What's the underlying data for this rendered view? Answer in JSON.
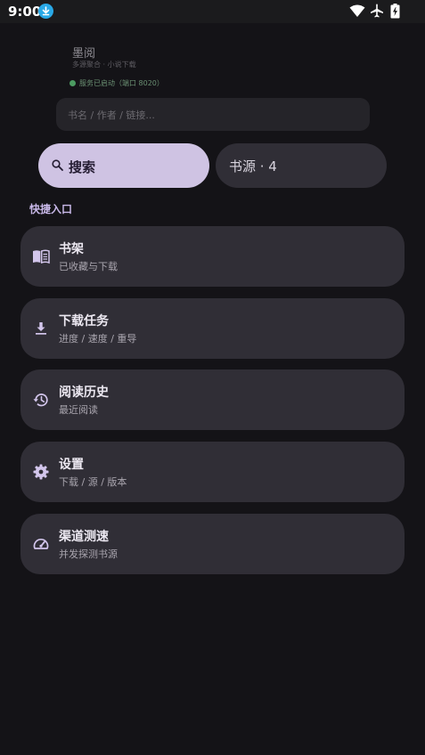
{
  "status_bar": {
    "time": "9:00"
  },
  "header": {
    "title": "墨阅",
    "subtitle": "多源聚合 · 小说下载",
    "server_status": "服务已启动（端口 8020）"
  },
  "search": {
    "placeholder": "书名 / 作者 / 链接..."
  },
  "actions": {
    "search_label": "搜索",
    "source_label": "书源 · 4"
  },
  "quick_access": {
    "label": "快捷入口",
    "items": [
      {
        "title": "书架",
        "subtitle": "已收藏与下载",
        "icon": "book-open-icon"
      },
      {
        "title": "下载任务",
        "subtitle": "进度 / 速度 / 重导",
        "icon": "download-icon"
      },
      {
        "title": "阅读历史",
        "subtitle": "最近阅读",
        "icon": "history-icon"
      },
      {
        "title": "设置",
        "subtitle": "下载 / 源 / 版本",
        "icon": "gear-icon"
      },
      {
        "title": "渠道测速",
        "subtitle": "并发探测书源",
        "icon": "speedometer-icon"
      }
    ]
  },
  "colors": {
    "background": "#141317",
    "card": "#302e36",
    "accent": "#cfc3e3",
    "section_label": "#c8b8e8",
    "status_ok": "#4c9b61"
  }
}
